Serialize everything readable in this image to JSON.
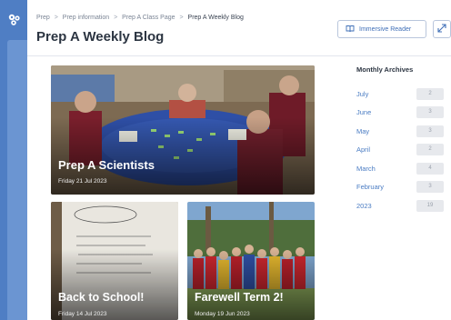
{
  "breadcrumb": [
    {
      "label": "Prep"
    },
    {
      "label": "Prep information"
    },
    {
      "label": "Prep A Class Page"
    },
    {
      "label": "Prep A Weekly Blog"
    }
  ],
  "breadcrumb_separator": ">",
  "page_title": "Prep A Weekly Blog",
  "toolbar": {
    "immersive_reader_label": "Immersive Reader"
  },
  "posts": [
    {
      "title": "Prep A Scientists",
      "date": "Friday 21 Jul 2023"
    },
    {
      "title": "Back to School!",
      "date": "Friday 14 Jul 2023"
    },
    {
      "title": "Farewell Term 2!",
      "date": "Monday 19 Jun 2023"
    }
  ],
  "archives": {
    "title": "Monthly Archives",
    "items": [
      {
        "label": "July",
        "count": "2"
      },
      {
        "label": "June",
        "count": "3"
      },
      {
        "label": "May",
        "count": "3"
      },
      {
        "label": "April",
        "count": "2"
      },
      {
        "label": "March",
        "count": "4"
      },
      {
        "label": "February",
        "count": "3"
      },
      {
        "label": "2023",
        "count": "19"
      }
    ]
  },
  "colors": {
    "rail": "#4f7ec4",
    "link": "#4a7cc3",
    "title": "#2c3542"
  },
  "icons": {
    "app": "app-logo-icon",
    "immersive_reader": "immersive-reader-icon",
    "expand": "expand-icon"
  }
}
